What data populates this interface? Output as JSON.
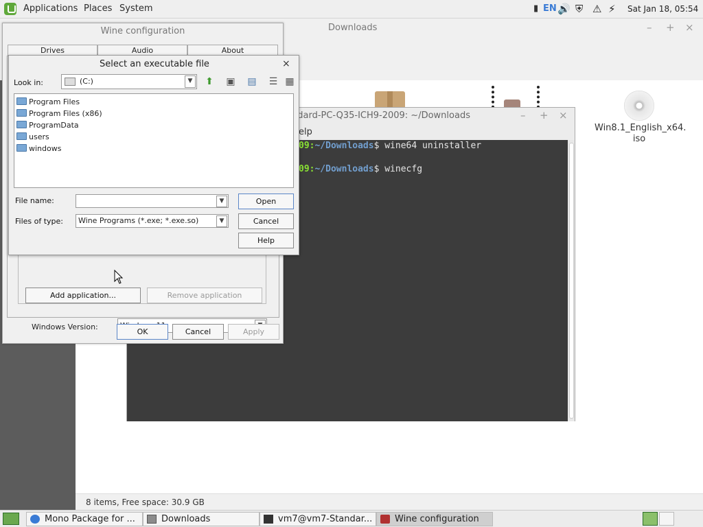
{
  "top_panel": {
    "menus": [
      "Applications",
      "Places",
      "System"
    ],
    "keyboard_layout": "EN",
    "clock": "Sat Jan 18, 05:54"
  },
  "files_window": {
    "title": "Downloads",
    "status": "8 items, Free space: 30.9 GB",
    "iso_label": "Win8.1_English_x64.\niso"
  },
  "terminal": {
    "title": "ndard-PC-Q35-ICH9-2009: ~/Downloads",
    "menu_help": "elp",
    "lines": [
      {
        "host": "09",
        "path": "~/Downloads",
        "cmd": "$ wine64 uninstaller"
      },
      {
        "host": "09",
        "path": "~/Downloads",
        "cmd": "$ winecfg"
      }
    ]
  },
  "winecfg": {
    "title": "Wine configuration",
    "tabs": [
      "Drives",
      "Audio",
      "About"
    ],
    "add_app": "Add application...",
    "remove_app": "Remove application",
    "windows_version_label": "Windows Version:",
    "windows_version": "Windows 11",
    "ok": "OK",
    "cancel": "Cancel",
    "apply": "Apply"
  },
  "file_dialog": {
    "title": "Select an executable file",
    "look_in_label": "Look in:",
    "look_in_value": "(C:)",
    "items": [
      "Program Files",
      "Program Files (x86)",
      "ProgramData",
      "users",
      "windows"
    ],
    "file_name_label": "File name:",
    "file_name_value": "",
    "files_of_type_label": "Files of type:",
    "files_of_type_value": "Wine Programs (*.exe; *.exe.so)",
    "open": "Open",
    "cancel": "Cancel",
    "help": "Help"
  },
  "taskbar": {
    "tasks": [
      "Mono Package for ...",
      "Downloads",
      "vm7@vm7-Standar...",
      "Wine configuration"
    ]
  },
  "colors": {
    "prompt_green": "#8ae234",
    "prompt_blue": "#729fcf",
    "mint_green": "#5fa83a"
  }
}
